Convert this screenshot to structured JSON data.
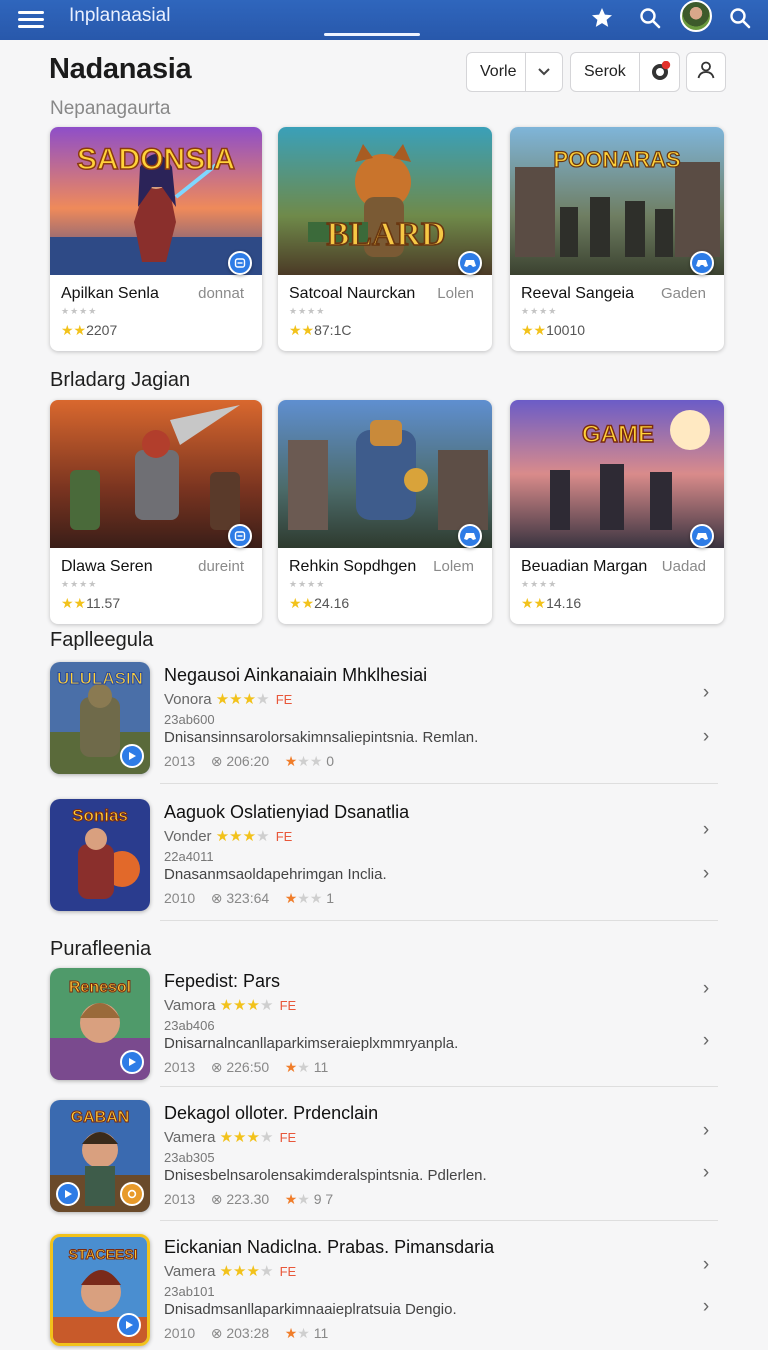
{
  "header": {
    "title": "Inplanaasial",
    "menu_icon": "hamburger-menu-icon",
    "star_icon": "star-icon",
    "search_icon": "search-icon",
    "avatar": "user-avatar"
  },
  "page": {
    "title": "Nadanasia",
    "subtitle": "Nepanagaurta"
  },
  "controls": {
    "dropdown_label": "Vorle",
    "sort_label": "Serok",
    "notification_dot": "red"
  },
  "sections": [
    {
      "title": "",
      "cards": [
        {
          "name": "Apilkan Senla",
          "tag": "donnat",
          "count": "2207",
          "stars": "★★",
          "art_text": "SADONSIA"
        },
        {
          "name": "Satcoal Naurckan",
          "tag": "Lolen",
          "count": "87:1C",
          "stars": "★★",
          "art_text": "BLARD"
        },
        {
          "name": "Reeval Sangeia",
          "tag": "Gaden",
          "count": "10010",
          "stars": "★★",
          "art_text": "POONARAS"
        }
      ]
    },
    {
      "title": "Brladarg Jagian",
      "cards": [
        {
          "name": "Dlawa Seren",
          "tag": "dureint",
          "count": "11.57",
          "stars": "★★",
          "art_text": ""
        },
        {
          "name": "Rehkin Sopdhgen",
          "tag": "Lolem",
          "count": "24.16",
          "stars": "★★",
          "art_text": ""
        },
        {
          "name": "Beuadian Margan",
          "tag": "Uadad",
          "count": "14.16",
          "stars": "★★",
          "art_text": "GAME"
        }
      ]
    }
  ],
  "list_sections": [
    {
      "title": "Faplleegula",
      "items": [
        {
          "title": "Negausoi Ainkanaiain Mhklhesiai",
          "meta_label": "Vonora",
          "stars": "★★★",
          "gray_star": "★",
          "fe": "FE",
          "code": "23ab600",
          "desc": "Dnisansinnsarolorsakimnsaliepintsnia. Remlan.",
          "year": "2013",
          "time": "206:20",
          "rating_stars": "★",
          "rating_gray": "★★",
          "rating_num": "0",
          "art_text": "ULULASIN"
        },
        {
          "title": "Aaguok Oslatienyiad Dsanatlia",
          "meta_label": "Vonder",
          "stars": "★★★",
          "gray_star": "★",
          "fe": "FE",
          "code": "22a4011",
          "desc": "Dnasanmsaoldapehrimgan Inclia.",
          "year": "2010",
          "time": "323:64",
          "rating_stars": "★",
          "rating_gray": "★★",
          "rating_num": "1",
          "art_text": "Sonias"
        }
      ]
    },
    {
      "title": "Purafleenia",
      "items": [
        {
          "title": "Fepedist: Pars",
          "meta_label": "Vamora",
          "stars": "★★★",
          "gray_star": "★",
          "fe": "FE",
          "code": "23ab406",
          "desc": "Dnisarnalncanllaparkimseraieplxmmryanpla.",
          "year": "2013",
          "time": "226:50",
          "rating_stars": "★",
          "rating_gray": "★",
          "rating_num": "11",
          "art_text": "Renesol"
        },
        {
          "title": "Dekagol olloter. Prdenclain",
          "meta_label": "Vamera",
          "stars": "★★★",
          "gray_star": "★",
          "fe": "FE",
          "code": "23ab305",
          "desc": "Dnisesbelnsarolensakimderalspintsnia. Pdlerlen.",
          "year": "2013",
          "time": "223.30",
          "rating_stars": "★",
          "rating_gray": "★",
          "rating_num": "9 7",
          "art_text": "GABAN"
        },
        {
          "title": "Eickanian Nadiclna. Prabas. Pimansdaria",
          "meta_label": "Vamera",
          "stars": "★★★",
          "gray_star": "★",
          "fe": "FE",
          "code": "23ab101",
          "desc": "Dnisadmsanllaparkimnaaieplratsuia Dengio.",
          "year": "2010",
          "time": "203:28",
          "rating_stars": "★",
          "rating_gray": "★",
          "rating_num": "11",
          "art_text": "STACEESI"
        }
      ]
    }
  ],
  "colors": {
    "topbar": "#2a5db0",
    "badge": "#2e7ce6",
    "star_yellow": "#f2c21b",
    "star_orange": "#f07d2a",
    "fe_red": "#e8573a"
  }
}
